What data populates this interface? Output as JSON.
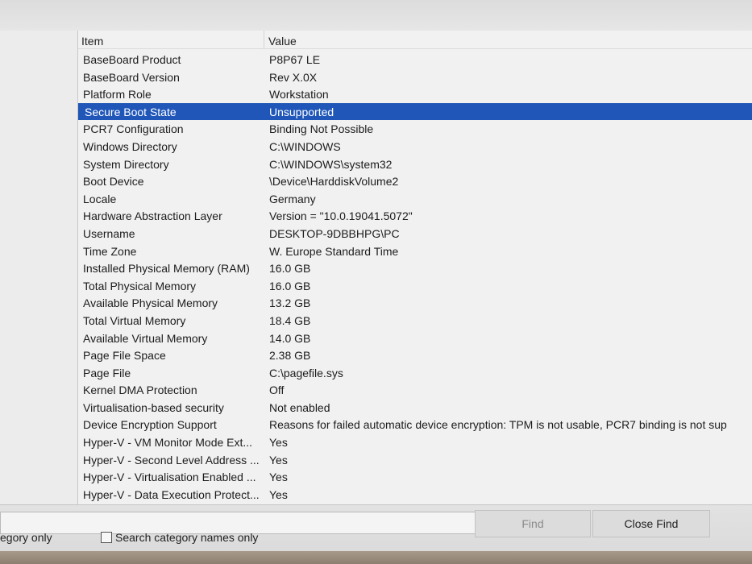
{
  "list": {
    "header": {
      "item": "Item",
      "value": "Value"
    },
    "rows": [
      {
        "item": "BaseBoard Product",
        "value": "P8P67 LE"
      },
      {
        "item": "BaseBoard Version",
        "value": "Rev X.0X"
      },
      {
        "item": "Platform Role",
        "value": "Workstation"
      },
      {
        "item": "Secure Boot State",
        "value": "Unsupported",
        "selected": true
      },
      {
        "item": "PCR7 Configuration",
        "value": "Binding Not Possible"
      },
      {
        "item": "Windows Directory",
        "value": "C:\\WINDOWS"
      },
      {
        "item": "System Directory",
        "value": "C:\\WINDOWS\\system32"
      },
      {
        "item": "Boot Device",
        "value": "\\Device\\HarddiskVolume2"
      },
      {
        "item": "Locale",
        "value": "Germany"
      },
      {
        "item": "Hardware Abstraction Layer",
        "value": "Version = \"10.0.19041.5072\""
      },
      {
        "item": "Username",
        "value": "DESKTOP-9DBBHPG\\PC"
      },
      {
        "item": "Time Zone",
        "value": "W. Europe Standard Time"
      },
      {
        "item": "Installed Physical Memory (RAM)",
        "value": "16.0 GB"
      },
      {
        "item": "Total Physical Memory",
        "value": "16.0 GB"
      },
      {
        "item": "Available Physical Memory",
        "value": "13.2 GB"
      },
      {
        "item": "Total Virtual Memory",
        "value": "18.4 GB"
      },
      {
        "item": "Available Virtual Memory",
        "value": "14.0 GB"
      },
      {
        "item": "Page File Space",
        "value": "2.38 GB"
      },
      {
        "item": "Page File",
        "value": "C:\\pagefile.sys"
      },
      {
        "item": "Kernel DMA Protection",
        "value": "Off"
      },
      {
        "item": "Virtualisation-based security",
        "value": "Not enabled"
      },
      {
        "item": "Device Encryption Support",
        "value": "Reasons for failed automatic device encryption: TPM is not usable, PCR7 binding is not sup"
      },
      {
        "item": "Hyper-V - VM Monitor Mode Ext...",
        "value": "Yes"
      },
      {
        "item": "Hyper-V - Second Level Address ...",
        "value": "Yes"
      },
      {
        "item": "Hyper-V - Virtualisation Enabled ...",
        "value": "Yes"
      },
      {
        "item": "Hyper-V - Data Execution Protect...",
        "value": "Yes"
      }
    ]
  },
  "find_bar": {
    "find_input_value": "",
    "find_button": "Find",
    "close_find_button": "Close Find",
    "search_selected_category_only_label": "egory only",
    "search_category_names_only_label": "Search category names only"
  },
  "colors": {
    "selection": "#1f56b8",
    "disabled_text": "#8a8a8a"
  }
}
